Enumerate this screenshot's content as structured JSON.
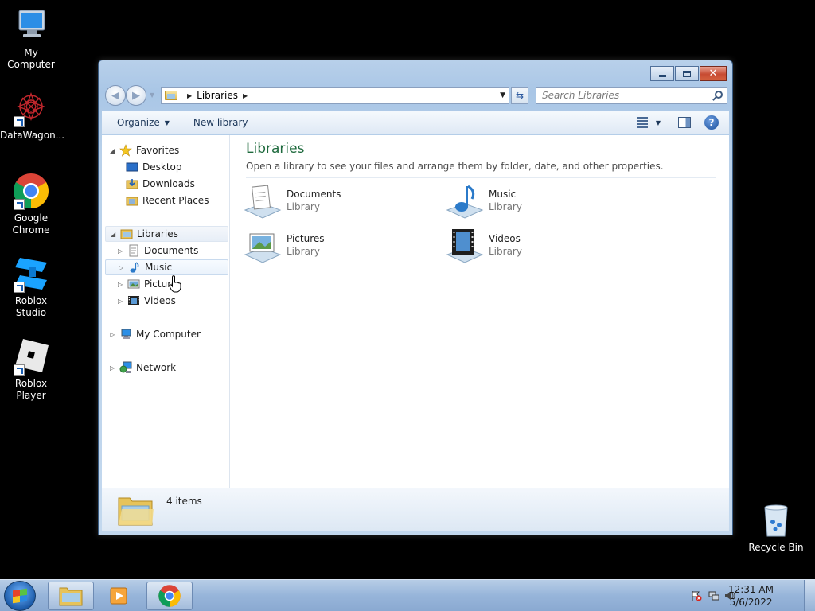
{
  "desktop": {
    "icons": [
      {
        "label": "My Computer"
      },
      {
        "label": "DataWagon..."
      },
      {
        "label": "Google Chrome"
      },
      {
        "label": "Roblox Studio"
      },
      {
        "label": "Roblox Player"
      },
      {
        "label": "Recycle Bin"
      }
    ]
  },
  "window": {
    "address": {
      "crumb": "Libraries"
    },
    "search": {
      "placeholder": "Search Libraries"
    },
    "toolbar": {
      "organize_label": "Organize",
      "new_library_label": "New library"
    },
    "nav": {
      "favorites": "Favorites",
      "desktop": "Desktop",
      "downloads": "Downloads",
      "recent_places": "Recent Places",
      "libraries": "Libraries",
      "documents": "Documents",
      "music": "Music",
      "pictures": "Pictures",
      "videos": "Videos",
      "my_computer": "My Computer",
      "network": "Network"
    },
    "content": {
      "title": "Libraries",
      "description": "Open a library to see your files and arrange them by folder, date, and other properties.",
      "libraries": [
        {
          "name": "Documents",
          "kind": "Library"
        },
        {
          "name": "Music",
          "kind": "Library"
        },
        {
          "name": "Pictures",
          "kind": "Library"
        },
        {
          "name": "Videos",
          "kind": "Library"
        }
      ]
    },
    "details": {
      "count": "4 items"
    }
  },
  "taskbar": {
    "time": "12:31 AM",
    "date": "5/6/2022"
  },
  "colors": {
    "library_title": "#1e6a3d",
    "title_bar": "#a9c6e6",
    "taskbar": "#97b5da"
  }
}
